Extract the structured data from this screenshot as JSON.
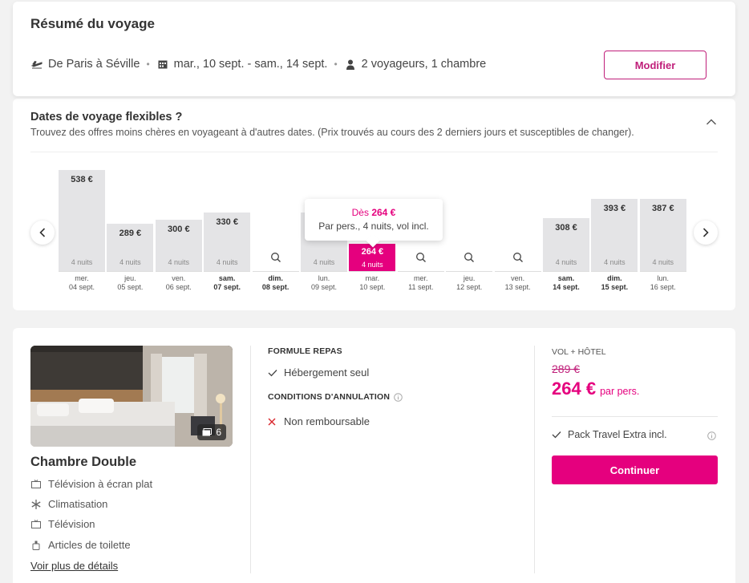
{
  "summary": {
    "title": "Résumé du voyage",
    "route": "De Paris à Séville",
    "dates": "mar., 10 sept. - sam., 14 sept.",
    "travelers": "2 voyageurs, 1 chambre",
    "edit_label": "Modifier"
  },
  "flex_dates": {
    "title": "Dates de voyage flexibles ?",
    "subtitle": "Trouvez des offres moins chères en voyageant à d'autres dates. (Prix trouvés au cours des 2 derniers jours et susceptibles de changer).",
    "tooltip": {
      "prefix": "Dès",
      "price": "264 €",
      "detail": "Par pers., 4 nuits, vol incl."
    },
    "days": [
      {
        "day": "mer.",
        "date": "04 sept.",
        "price": "538 €",
        "nights": "4 nuits",
        "level": 1.0,
        "weekend": false,
        "selected": false
      },
      {
        "day": "jeu.",
        "date": "05 sept.",
        "price": "289 €",
        "nights": "4 nuits",
        "level": 0.3,
        "weekend": false,
        "selected": false
      },
      {
        "day": "ven.",
        "date": "06 sept.",
        "price": "300 €",
        "nights": "4 nuits",
        "level": 0.35,
        "weekend": false,
        "selected": false
      },
      {
        "day": "sam.",
        "date": "07 sept.",
        "price": "330 €",
        "nights": "4 nuits",
        "level": 0.45,
        "weekend": true,
        "selected": false
      },
      {
        "day": "dim.",
        "date": "08 sept.",
        "price": null,
        "nights": "",
        "level": 0,
        "weekend": true,
        "selected": false
      },
      {
        "day": "lun.",
        "date": "09 sept.",
        "price": "",
        "nights": "4 nuits",
        "level": 0.45,
        "weekend": false,
        "selected": false
      },
      {
        "day": "mar.",
        "date": "10 sept.",
        "price": "264 €",
        "nights": "4 nuits",
        "level": 0.27,
        "weekend": false,
        "selected": true
      },
      {
        "day": "mer.",
        "date": "11 sept.",
        "price": null,
        "nights": "",
        "level": 0,
        "weekend": false,
        "selected": false
      },
      {
        "day": "jeu.",
        "date": "12 sept.",
        "price": null,
        "nights": "",
        "level": 0,
        "weekend": false,
        "selected": false
      },
      {
        "day": "ven.",
        "date": "13 sept.",
        "price": null,
        "nights": "",
        "level": 0,
        "weekend": false,
        "selected": false
      },
      {
        "day": "sam.",
        "date": "14 sept.",
        "price": "308 €",
        "nights": "4 nuits",
        "level": 0.38,
        "weekend": true,
        "selected": false
      },
      {
        "day": "dim.",
        "date": "15 sept.",
        "price": "393 €",
        "nights": "4 nuits",
        "level": 0.62,
        "weekend": true,
        "selected": false
      },
      {
        "day": "lun.",
        "date": "16 sept.",
        "price": "387 €",
        "nights": "4 nuits",
        "level": 0.62,
        "weekend": false,
        "selected": false
      }
    ]
  },
  "room": {
    "photo_count": "6",
    "name": "Chambre Double",
    "amenities": [
      {
        "icon": "tv-icon",
        "label": "Télévision à écran plat"
      },
      {
        "icon": "snowflake-icon",
        "label": "Climatisation"
      },
      {
        "icon": "tv-icon",
        "label": "Télévision"
      },
      {
        "icon": "toiletries-icon",
        "label": "Articles de toilette"
      }
    ],
    "details_link": "Voir plus de détails",
    "meal_title": "FORMULE REPAS",
    "meal_option": "Hébergement seul",
    "cancel_title": "CONDITIONS D'ANNULATION",
    "cancel_option": "Non remboursable",
    "price_label": "VOL + HÔTEL",
    "old_price": "289 €",
    "new_price": "264 €",
    "per_person": "par pers.",
    "pack": "Pack Travel Extra incl.",
    "continue_label": "Continuer"
  },
  "colors": {
    "accent": "#e5007e",
    "accent_dark": "#c01f7a",
    "bar": "#e4e4e6"
  }
}
